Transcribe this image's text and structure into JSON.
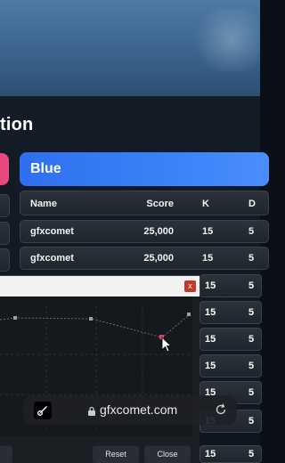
{
  "header": {
    "title_fragment": "tion"
  },
  "tabs": {
    "blue_label": "Blue"
  },
  "table": {
    "columns": [
      "Name",
      "Score",
      "K",
      "D"
    ],
    "rows": [
      {
        "name": "gfxcomet",
        "score": "25,000",
        "k": "15",
        "d": "5"
      },
      {
        "name": "gfxcomet",
        "score": "25,000",
        "k": "15",
        "d": "5"
      }
    ],
    "side_rows": [
      {
        "k": "15",
        "d": "5"
      },
      {
        "k": "15",
        "d": "5"
      },
      {
        "k": "15",
        "d": "5"
      },
      {
        "k": "15",
        "d": "5"
      },
      {
        "k": "15",
        "d": "5"
      },
      {
        "k": "15",
        "d": "5"
      },
      {
        "k": "15",
        "d": "5"
      }
    ]
  },
  "popup": {
    "close_label": "x",
    "reset_label": "Reset",
    "close_button_label": "Close"
  },
  "browser": {
    "url": "gfxcomet.com"
  },
  "colors": {
    "blue_tab": "#3b82f6",
    "red_tab": "#e84a7f",
    "close_red": "#c0392b"
  }
}
